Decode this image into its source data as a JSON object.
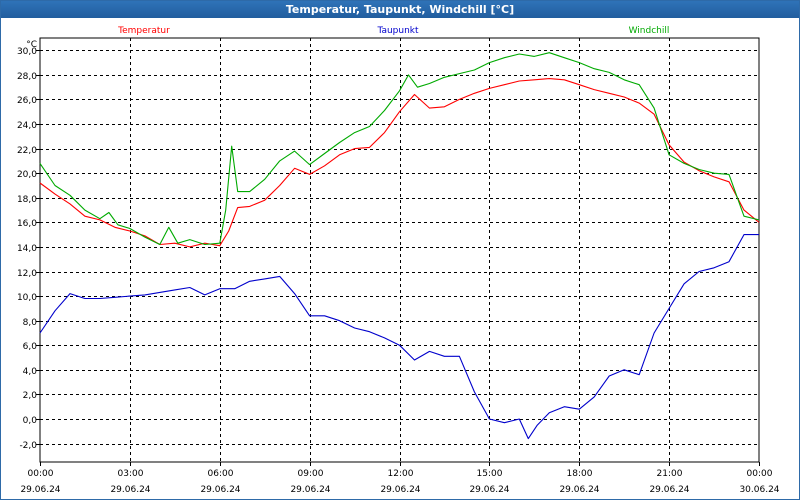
{
  "window": {
    "title": "Temperatur, Taupunkt, Windchill [°C]"
  },
  "chart_data": {
    "type": "line",
    "title": "Temperatur, Taupunkt, Windchill [°C]",
    "yunit": "°C",
    "ylim": [
      -3.5,
      31
    ],
    "yticks": [
      "30,0",
      "28,0",
      "26,0",
      "24,0",
      "22,0",
      "20,0",
      "18,0",
      "16,0",
      "14,0",
      "12,0",
      "10,0",
      "8,0",
      "6,0",
      "4,0",
      "2,0",
      "0,0",
      "-2,0"
    ],
    "ytick_values": [
      30,
      28,
      26,
      24,
      22,
      20,
      18,
      16,
      14,
      12,
      10,
      8,
      6,
      4,
      2,
      0,
      -2
    ],
    "xlim": [
      0,
      24
    ],
    "xticks": [
      {
        "time": "00:00",
        "date": "29.06.24",
        "hour": 0
      },
      {
        "time": "03:00",
        "date": "29.06.24",
        "hour": 3
      },
      {
        "time": "06:00",
        "date": "29.06.24",
        "hour": 6
      },
      {
        "time": "09:00",
        "date": "29.06.24",
        "hour": 9
      },
      {
        "time": "12:00",
        "date": "29.06.24",
        "hour": 12
      },
      {
        "time": "15:00",
        "date": "29.06.24",
        "hour": 15
      },
      {
        "time": "18:00",
        "date": "29.06.24",
        "hour": 18
      },
      {
        "time": "21:00",
        "date": "29.06.24",
        "hour": 21
      },
      {
        "time": "00:00",
        "date": "30.06.24",
        "hour": 24
      }
    ],
    "grid": true,
    "series": [
      {
        "name": "Temperatur",
        "color": "#ff0000",
        "x": [
          0,
          0.5,
          1,
          1.5,
          2,
          2.5,
          3,
          3.5,
          4,
          4.5,
          5,
          5.5,
          6,
          6.3,
          6.6,
          7,
          7.5,
          8,
          8.5,
          9,
          9.5,
          10,
          10.5,
          11,
          11.5,
          12,
          12.5,
          13,
          13.5,
          14,
          14.5,
          15,
          15.5,
          16,
          16.5,
          17,
          17.5,
          18,
          18.5,
          19,
          19.5,
          20,
          20.5,
          21,
          21.5,
          22,
          22.5,
          23,
          23.5,
          24
        ],
        "values": [
          19.2,
          18.3,
          17.5,
          16.5,
          16.2,
          15.6,
          15.3,
          14.9,
          14.2,
          14.3,
          14.0,
          14.3,
          14.1,
          15.3,
          17.2,
          17.3,
          17.8,
          19.0,
          20.4,
          19.9,
          20.6,
          21.5,
          22.0,
          22.1,
          23.3,
          25.0,
          26.4,
          25.3,
          25.4,
          26.0,
          26.5,
          26.9,
          27.2,
          27.5,
          27.6,
          27.7,
          27.6,
          27.2,
          26.8,
          26.5,
          26.2,
          25.7,
          24.8,
          22.3,
          20.9,
          20.2,
          19.7,
          19.3,
          17.0,
          16.0
        ]
      },
      {
        "name": "Taupunkt",
        "color": "#0000cc",
        "x": [
          0,
          0.5,
          1,
          1.5,
          2,
          2.5,
          3,
          3.5,
          4,
          4.5,
          5,
          5.5,
          6,
          6.5,
          7,
          7.5,
          8,
          8.5,
          9,
          9.5,
          10,
          10.5,
          11,
          11.5,
          12,
          12.5,
          13,
          13.5,
          14,
          14.5,
          15,
          15.5,
          16,
          16.3,
          16.6,
          17,
          17.5,
          18,
          18.5,
          19,
          19.5,
          20,
          20.5,
          21,
          21.5,
          22,
          22.5,
          23,
          23.5,
          24
        ],
        "values": [
          7.0,
          8.8,
          10.2,
          9.8,
          9.8,
          9.9,
          10.0,
          10.1,
          10.3,
          10.5,
          10.7,
          10.1,
          10.6,
          10.6,
          11.2,
          11.4,
          11.6,
          10.2,
          8.4,
          8.4,
          8.0,
          7.4,
          7.1,
          6.6,
          6.0,
          4.8,
          5.5,
          5.1,
          5.1,
          2.2,
          0.0,
          -0.3,
          0.0,
          -1.6,
          -0.5,
          0.5,
          1.0,
          0.8,
          1.8,
          3.5,
          4.0,
          3.6,
          7.0,
          9.0,
          11.0,
          12.0,
          12.3,
          12.8,
          15.0,
          15.0
        ]
      },
      {
        "name": "Windchill",
        "color": "#00aa00",
        "x": [
          0,
          0.5,
          1,
          1.5,
          2,
          2.3,
          2.6,
          3,
          3.5,
          4,
          4.3,
          4.6,
          5,
          5.5,
          6,
          6.2,
          6.4,
          6.6,
          7,
          7.5,
          8,
          8.5,
          9,
          9.5,
          10,
          10.5,
          11,
          11.5,
          12,
          12.3,
          12.6,
          13,
          13.5,
          14,
          14.5,
          15,
          15.5,
          16,
          16.5,
          17,
          17.5,
          18,
          18.5,
          19,
          19.5,
          20,
          20.5,
          21,
          21.5,
          22,
          22.5,
          23,
          23.5,
          24
        ],
        "values": [
          20.8,
          19.0,
          18.2,
          17.0,
          16.3,
          16.8,
          15.8,
          15.5,
          14.8,
          14.2,
          15.6,
          14.3,
          14.6,
          14.2,
          14.3,
          17.0,
          22.2,
          18.5,
          18.5,
          19.5,
          21.0,
          21.8,
          20.7,
          21.6,
          22.5,
          23.3,
          23.8,
          25.1,
          26.7,
          28.0,
          27.0,
          27.3,
          27.8,
          28.1,
          28.4,
          29.0,
          29.4,
          29.7,
          29.5,
          29.8,
          29.4,
          29.0,
          28.5,
          28.2,
          27.6,
          27.2,
          25.3,
          21.5,
          20.8,
          20.3,
          20.0,
          19.9,
          16.5,
          16.2
        ]
      }
    ]
  }
}
